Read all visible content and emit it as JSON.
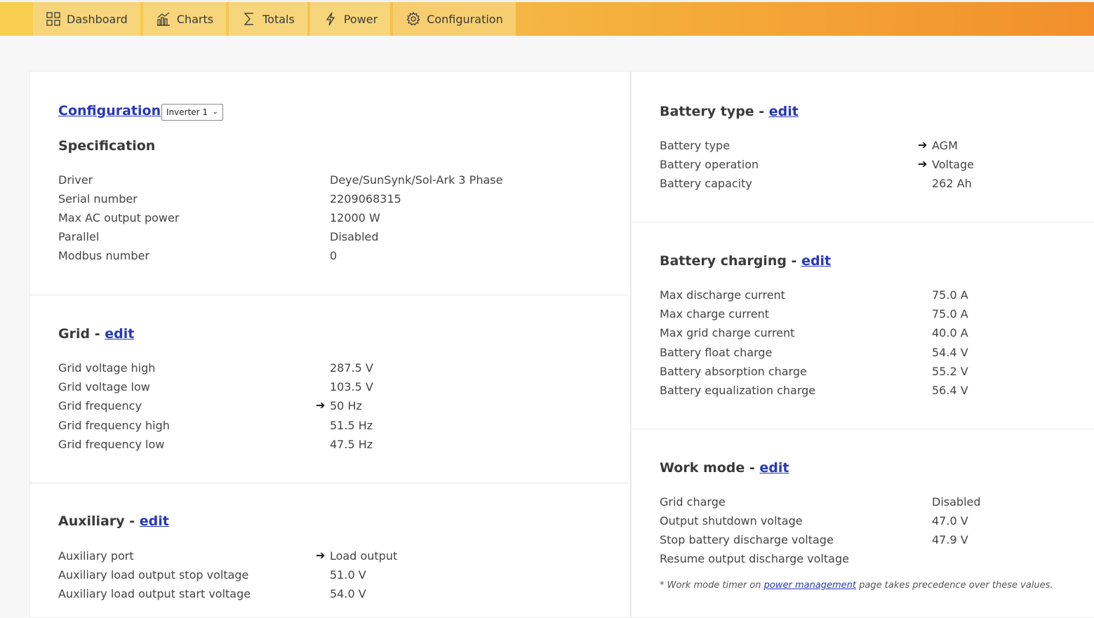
{
  "nav": {
    "tabs": [
      {
        "label": "Dashboard",
        "icon": "grid-icon"
      },
      {
        "label": "Charts",
        "icon": "bar-chart-icon"
      },
      {
        "label": "Totals",
        "icon": "sigma-icon"
      },
      {
        "label": "Power",
        "icon": "lightning-icon"
      },
      {
        "label": "Configuration",
        "icon": "gear-icon"
      }
    ]
  },
  "breadcrumb": {
    "link": "Configuration",
    "separator": "›",
    "inverter_select": "Inverter 1"
  },
  "specification": {
    "title": "Specification",
    "rows": [
      {
        "label": "Driver",
        "value": "Deye/SunSynk/Sol-Ark 3 Phase"
      },
      {
        "label": "Serial number",
        "value": "2209068315"
      },
      {
        "label": "Max AC output power",
        "value": "12000 W"
      },
      {
        "label": "Parallel",
        "value": "Disabled"
      },
      {
        "label": "Modbus number",
        "value": "0"
      }
    ]
  },
  "grid": {
    "title": "Grid - ",
    "edit": "edit",
    "rows": [
      {
        "label": "Grid voltage high",
        "value": "287.5 V"
      },
      {
        "label": "Grid voltage low",
        "value": "103.5 V"
      },
      {
        "label": "Grid frequency",
        "value": "50 Hz",
        "arrow": "➔"
      },
      {
        "label": "Grid frequency high",
        "value": "51.5 Hz"
      },
      {
        "label": "Grid frequency low",
        "value": "47.5 Hz"
      }
    ]
  },
  "auxiliary": {
    "title": "Auxiliary - ",
    "edit": "edit",
    "rows": [
      {
        "label": "Auxiliary port",
        "value": "Load output",
        "arrow": "➔"
      },
      {
        "label": "Auxiliary load output stop voltage",
        "value": "51.0 V"
      },
      {
        "label": "Auxiliary load output start voltage",
        "value": "54.0 V"
      }
    ]
  },
  "battery_type": {
    "title": "Battery type - ",
    "edit": "edit",
    "rows": [
      {
        "label": "Battery type",
        "value": "AGM",
        "arrow": "➔"
      },
      {
        "label": "Battery operation",
        "value": "Voltage",
        "arrow": "➔"
      },
      {
        "label": "Battery capacity",
        "value": "262 Ah"
      }
    ]
  },
  "battery_charging": {
    "title": "Battery charging - ",
    "edit": "edit",
    "rows": [
      {
        "label": "Max discharge current",
        "value": "75.0 A"
      },
      {
        "label": "Max charge current",
        "value": "75.0 A"
      },
      {
        "label": "Max grid charge current",
        "value": "40.0 A"
      },
      {
        "label": "Battery float charge",
        "value": "54.4 V"
      },
      {
        "label": "Battery absorption charge",
        "value": "55.2 V"
      },
      {
        "label": "Battery equalization charge",
        "value": "56.4 V"
      }
    ]
  },
  "work_mode": {
    "title": "Work mode - ",
    "edit": "edit",
    "rows": [
      {
        "label": "Grid charge",
        "value": "Disabled"
      },
      {
        "label": "Output shutdown voltage",
        "value": "47.0 V"
      },
      {
        "label": "Stop battery discharge voltage",
        "value": "47.9 V"
      },
      {
        "label": "Resume output discharge voltage",
        "value": ""
      }
    ],
    "note_prefix": "* Work mode timer on ",
    "note_link": "power management",
    "note_suffix": " page takes precedence over these values."
  }
}
